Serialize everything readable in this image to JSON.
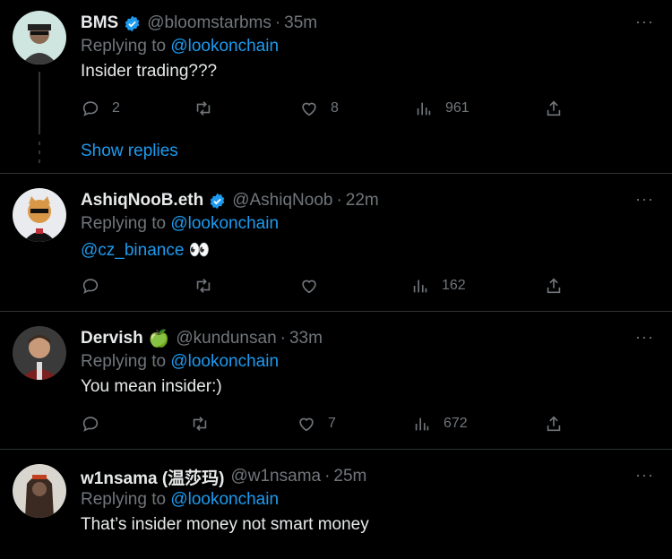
{
  "colors": {
    "accent": "#1d9bf0",
    "muted": "#71767b",
    "text": "#e7e9ea",
    "bg": "#000000"
  },
  "tweets": [
    {
      "name": "BMS",
      "verified": true,
      "handle": "@bloomstarbms",
      "time": "35m",
      "replying_prefix": "Replying to ",
      "replying_to": "@lookonchain",
      "text": "Insider trading???",
      "replies": "2",
      "retweets": "",
      "likes": "8",
      "views": "961"
    },
    {
      "name": "AshiqNooB.eth",
      "verified": true,
      "handle": "@AshiqNoob",
      "time": "22m",
      "replying_prefix": "Replying to ",
      "replying_to": "@lookonchain",
      "text_mention": "@cz_binance",
      "text_emoji": "👀",
      "replies": "",
      "retweets": "",
      "likes": "",
      "views": "162"
    },
    {
      "name": "Dervish",
      "emoji": "🍏",
      "handle": "@kundunsan",
      "time": "33m",
      "replying_prefix": "Replying to ",
      "replying_to": "@lookonchain",
      "text": "You mean insider:)",
      "replies": "",
      "retweets": "",
      "likes": "7",
      "views": "672"
    },
    {
      "name": "w1nsama (温莎玛)",
      "handle": "@w1nsama",
      "time": "25m",
      "replying_prefix": "Replying to ",
      "replying_to": "@lookonchain",
      "text": "That’s insider money not smart money"
    }
  ],
  "show_replies": "Show replies",
  "separator": "·",
  "more": "···"
}
